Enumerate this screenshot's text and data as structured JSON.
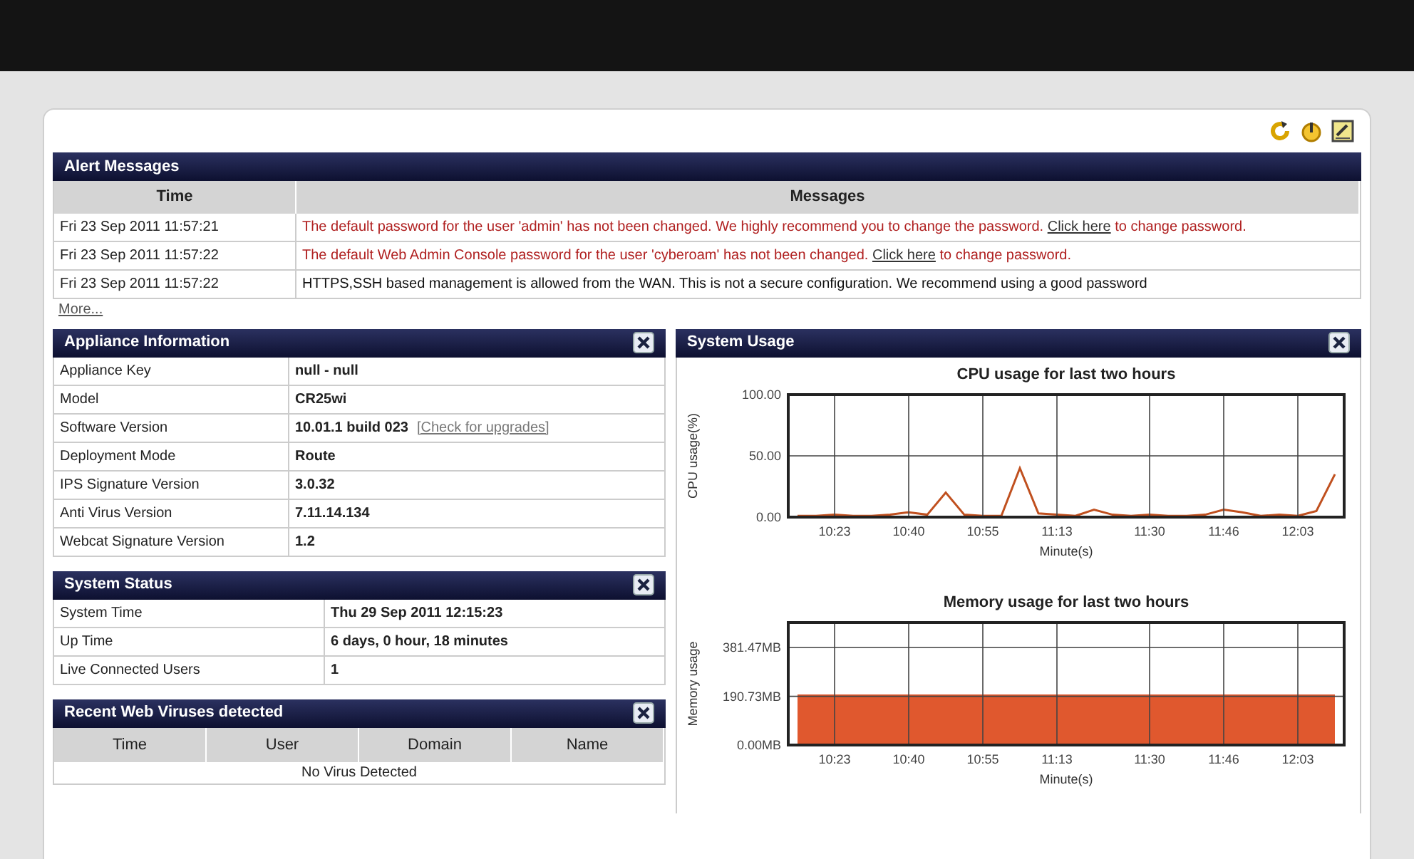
{
  "alert_messages": {
    "title": "Alert Messages",
    "columns": [
      "Time",
      "Messages"
    ],
    "rows": [
      {
        "time": "Fri 23 Sep 2011 11:57:21",
        "kind": "warning",
        "text": "The default password for the user 'admin' has not been changed. We highly recommend you to change the password.",
        "link": "Click here",
        "after": "to change password."
      },
      {
        "time": "Fri 23 Sep 2011 11:57:22",
        "kind": "warning",
        "text": "The default Web Admin Console password for the user 'cyberoam' has not been changed.",
        "link": "Click here",
        "after": "to change password."
      },
      {
        "time": "Fri 23 Sep 2011 11:57:22",
        "kind": "info",
        "text": "HTTPS,SSH based management is allowed from the WAN. This is not a secure configuration. We recommend using a good password"
      }
    ],
    "more_link": "More..."
  },
  "appliance_information": {
    "title": "Appliance Information",
    "rows": [
      {
        "label": "Appliance Key",
        "value": "null - null"
      },
      {
        "label": "Model",
        "value": "CR25wi"
      },
      {
        "label": "Software Version",
        "value": "10.01.1 build 023",
        "link": "[Check for upgrades]"
      },
      {
        "label": "Deployment Mode",
        "value": "Route"
      },
      {
        "label": "IPS Signature Version",
        "value": "3.0.32"
      },
      {
        "label": "Anti Virus Version",
        "value": "7.11.14.134"
      },
      {
        "label": "Webcat Signature Version",
        "value": "1.2"
      }
    ]
  },
  "system_status": {
    "title": "System Status",
    "rows": [
      {
        "label": "System Time",
        "value": "Thu 29 Sep 2011 12:15:23"
      },
      {
        "label": "Up Time",
        "value": "6 days, 0 hour, 18 minutes"
      },
      {
        "label": "Live Connected Users",
        "value": "1"
      }
    ]
  },
  "recent_web_viruses": {
    "title": "Recent Web Viruses detected",
    "columns": [
      "Time",
      "User",
      "Domain",
      "Name"
    ],
    "empty_message": "No Virus Detected"
  },
  "system_usage": {
    "title": "System Usage",
    "charts": [
      {
        "chart_data": {
          "type": "line",
          "title": "CPU usage for last two hours",
          "xlabel": "Minute(s)",
          "ylabel": "CPU usage(%)",
          "categories": [
            null,
            null,
            "10:23",
            null,
            null,
            null,
            "10:40",
            null,
            null,
            null,
            "10:55",
            null,
            null,
            null,
            "11:13",
            null,
            null,
            null,
            null,
            "11:30",
            null,
            null,
            null,
            "11:46",
            null,
            null,
            null,
            "12:03",
            null,
            null
          ],
          "series": [
            {
              "color": "#c0501f",
              "values": [
                1,
                1,
                2,
                1,
                1,
                2,
                4,
                2,
                20,
                2,
                1,
                1,
                40,
                3,
                2,
                1,
                6,
                2,
                1,
                2,
                1,
                1,
                2,
                6,
                4,
                1,
                2,
                1,
                5,
                35
              ]
            }
          ],
          "ylim": [
            0,
            100
          ],
          "grid": true,
          "yticks": [
            {
              "value": 0,
              "label": "0.00"
            },
            {
              "value": 50,
              "label": "50.00"
            },
            {
              "value": 100,
              "label": "100.00"
            }
          ]
        }
      },
      {
        "chart_data": {
          "type": "area",
          "title": "Memory usage for last two hours",
          "xlabel": "Minute(s)",
          "ylabel": "Memory usage",
          "categories": [
            null,
            null,
            "10:23",
            null,
            null,
            null,
            "10:40",
            null,
            null,
            null,
            "10:55",
            null,
            null,
            null,
            "11:13",
            null,
            null,
            null,
            null,
            "11:30",
            null,
            null,
            null,
            "11:46",
            null,
            null,
            null,
            "12:03",
            null,
            null
          ],
          "series": [
            {
              "color": "#e0582e",
              "values": [
                198,
                198,
                198,
                198,
                198,
                198,
                198,
                198,
                198,
                198,
                198,
                198,
                198,
                198,
                198,
                198,
                198,
                198,
                198,
                198,
                198,
                198,
                198,
                198,
                198,
                198,
                198,
                198,
                198,
                198
              ]
            }
          ],
          "ylim": [
            0,
            480
          ],
          "grid": true,
          "yticks": [
            {
              "value": 0,
              "label": "0.00MB"
            },
            {
              "value": 190.73,
              "label": "190.73MB"
            },
            {
              "value": 381.47,
              "label": "381.47MB"
            }
          ]
        }
      }
    ]
  }
}
